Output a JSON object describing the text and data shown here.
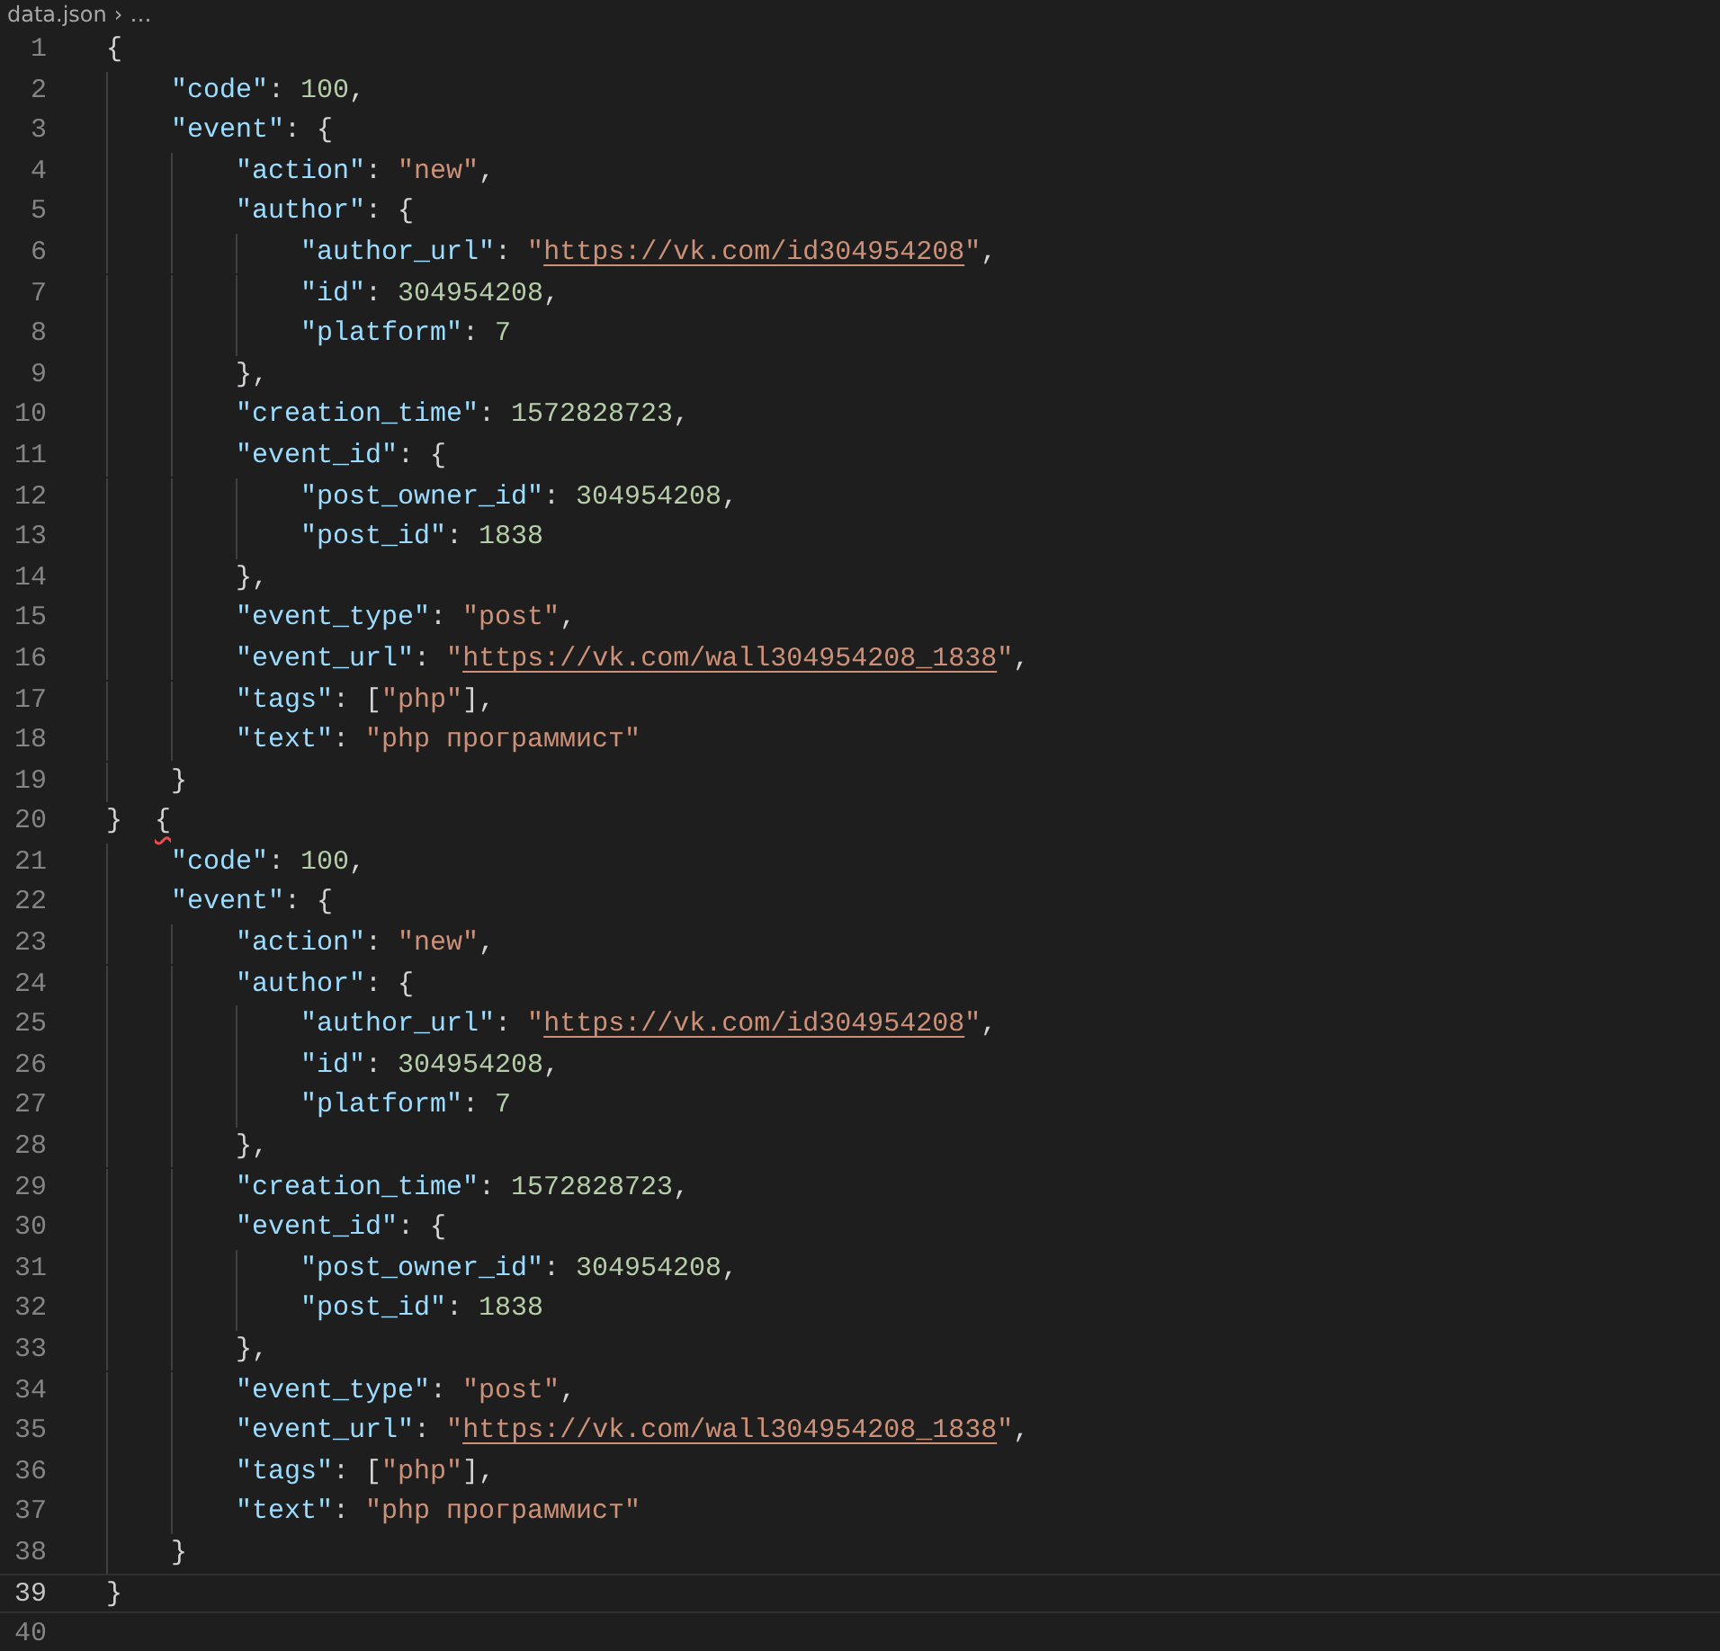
{
  "breadcrumb": {
    "file": "data.json",
    "separator": "›",
    "rest": "…"
  },
  "lines": [
    {
      "number": "1",
      "current": false,
      "tokens": [
        {
          "kind": "punct",
          "text": "{"
        }
      ],
      "children": [
        {
          "number": "2",
          "current": false,
          "tokens": [
            {
              "kind": "key",
              "text": "\"code\""
            },
            {
              "kind": "punct",
              "text": ": "
            },
            {
              "kind": "num",
              "text": "100"
            },
            {
              "kind": "punct",
              "text": ","
            }
          ]
        },
        {
          "number": "3",
          "current": false,
          "tokens": [
            {
              "kind": "key",
              "text": "\"event\""
            },
            {
              "kind": "punct",
              "text": ": {"
            }
          ],
          "children": [
            {
              "number": "4",
              "current": false,
              "tokens": [
                {
                  "kind": "key",
                  "text": "\"action\""
                },
                {
                  "kind": "punct",
                  "text": ": "
                },
                {
                  "kind": "str",
                  "text": "\"new\""
                },
                {
                  "kind": "punct",
                  "text": ","
                }
              ]
            },
            {
              "number": "5",
              "current": false,
              "tokens": [
                {
                  "kind": "key",
                  "text": "\"author\""
                },
                {
                  "kind": "punct",
                  "text": ": {"
                }
              ],
              "children": [
                {
                  "number": "6",
                  "current": false,
                  "tokens": [
                    {
                      "kind": "key",
                      "text": "\"author_url\""
                    },
                    {
                      "kind": "punct",
                      "text": ": "
                    },
                    {
                      "kind": "str",
                      "text": "\""
                    },
                    {
                      "kind": "url",
                      "text": "https://vk.com/id304954208"
                    },
                    {
                      "kind": "str",
                      "text": "\""
                    },
                    {
                      "kind": "punct",
                      "text": ","
                    }
                  ]
                },
                {
                  "number": "7",
                  "current": false,
                  "tokens": [
                    {
                      "kind": "key",
                      "text": "\"id\""
                    },
                    {
                      "kind": "punct",
                      "text": ": "
                    },
                    {
                      "kind": "num",
                      "text": "304954208"
                    },
                    {
                      "kind": "punct",
                      "text": ","
                    }
                  ]
                },
                {
                  "number": "8",
                  "current": false,
                  "tokens": [
                    {
                      "kind": "key",
                      "text": "\"platform\""
                    },
                    {
                      "kind": "punct",
                      "text": ": "
                    },
                    {
                      "kind": "num",
                      "text": "7"
                    }
                  ]
                }
              ]
            },
            {
              "number": "9",
              "current": false,
              "tokens": [
                {
                  "kind": "punct",
                  "text": "},"
                }
              ]
            },
            {
              "number": "10",
              "current": false,
              "tokens": [
                {
                  "kind": "key",
                  "text": "\"creation_time\""
                },
                {
                  "kind": "punct",
                  "text": ": "
                },
                {
                  "kind": "num",
                  "text": "1572828723"
                },
                {
                  "kind": "punct",
                  "text": ","
                }
              ]
            },
            {
              "number": "11",
              "current": false,
              "tokens": [
                {
                  "kind": "key",
                  "text": "\"event_id\""
                },
                {
                  "kind": "punct",
                  "text": ": {"
                }
              ],
              "children": [
                {
                  "number": "12",
                  "current": false,
                  "tokens": [
                    {
                      "kind": "key",
                      "text": "\"post_owner_id\""
                    },
                    {
                      "kind": "punct",
                      "text": ": "
                    },
                    {
                      "kind": "num",
                      "text": "304954208"
                    },
                    {
                      "kind": "punct",
                      "text": ","
                    }
                  ]
                },
                {
                  "number": "13",
                  "current": false,
                  "tokens": [
                    {
                      "kind": "key",
                      "text": "\"post_id\""
                    },
                    {
                      "kind": "punct",
                      "text": ": "
                    },
                    {
                      "kind": "num",
                      "text": "1838"
                    }
                  ]
                }
              ]
            },
            {
              "number": "14",
              "current": false,
              "tokens": [
                {
                  "kind": "punct",
                  "text": "},"
                }
              ]
            },
            {
              "number": "15",
              "current": false,
              "tokens": [
                {
                  "kind": "key",
                  "text": "\"event_type\""
                },
                {
                  "kind": "punct",
                  "text": ": "
                },
                {
                  "kind": "str",
                  "text": "\"post\""
                },
                {
                  "kind": "punct",
                  "text": ","
                }
              ]
            },
            {
              "number": "16",
              "current": false,
              "tokens": [
                {
                  "kind": "key",
                  "text": "\"event_url\""
                },
                {
                  "kind": "punct",
                  "text": ": "
                },
                {
                  "kind": "str",
                  "text": "\""
                },
                {
                  "kind": "url",
                  "text": "https://vk.com/wall304954208_1838"
                },
                {
                  "kind": "str",
                  "text": "\""
                },
                {
                  "kind": "punct",
                  "text": ","
                }
              ]
            },
            {
              "number": "17",
              "current": false,
              "tokens": [
                {
                  "kind": "key",
                  "text": "\"tags\""
                },
                {
                  "kind": "punct",
                  "text": ": ["
                },
                {
                  "kind": "str",
                  "text": "\"php\""
                },
                {
                  "kind": "punct",
                  "text": "],"
                }
              ]
            },
            {
              "number": "18",
              "current": false,
              "tokens": [
                {
                  "kind": "key",
                  "text": "\"text\""
                },
                {
                  "kind": "punct",
                  "text": ": "
                },
                {
                  "kind": "str",
                  "text": "\"php программист\""
                }
              ]
            }
          ]
        },
        {
          "number": "19",
          "current": false,
          "tokens": [
            {
              "kind": "punct",
              "text": "}"
            }
          ]
        }
      ]
    },
    {
      "number": "20",
      "current": false,
      "tokens": [
        {
          "kind": "punct",
          "text": "}  "
        },
        {
          "kind": "punct",
          "text": "{",
          "error": true
        }
      ],
      "children": [
        {
          "number": "21",
          "current": false,
          "tokens": [
            {
              "kind": "key",
              "text": "\"code\""
            },
            {
              "kind": "punct",
              "text": ": "
            },
            {
              "kind": "num",
              "text": "100"
            },
            {
              "kind": "punct",
              "text": ","
            }
          ]
        },
        {
          "number": "22",
          "current": false,
          "tokens": [
            {
              "kind": "key",
              "text": "\"event\""
            },
            {
              "kind": "punct",
              "text": ": {"
            }
          ],
          "children": [
            {
              "number": "23",
              "current": false,
              "tokens": [
                {
                  "kind": "key",
                  "text": "\"action\""
                },
                {
                  "kind": "punct",
                  "text": ": "
                },
                {
                  "kind": "str",
                  "text": "\"new\""
                },
                {
                  "kind": "punct",
                  "text": ","
                }
              ]
            },
            {
              "number": "24",
              "current": false,
              "tokens": [
                {
                  "kind": "key",
                  "text": "\"author\""
                },
                {
                  "kind": "punct",
                  "text": ": {"
                }
              ],
              "children": [
                {
                  "number": "25",
                  "current": false,
                  "tokens": [
                    {
                      "kind": "key",
                      "text": "\"author_url\""
                    },
                    {
                      "kind": "punct",
                      "text": ": "
                    },
                    {
                      "kind": "str",
                      "text": "\""
                    },
                    {
                      "kind": "url",
                      "text": "https://vk.com/id304954208"
                    },
                    {
                      "kind": "str",
                      "text": "\""
                    },
                    {
                      "kind": "punct",
                      "text": ","
                    }
                  ]
                },
                {
                  "number": "26",
                  "current": false,
                  "tokens": [
                    {
                      "kind": "key",
                      "text": "\"id\""
                    },
                    {
                      "kind": "punct",
                      "text": ": "
                    },
                    {
                      "kind": "num",
                      "text": "304954208"
                    },
                    {
                      "kind": "punct",
                      "text": ","
                    }
                  ]
                },
                {
                  "number": "27",
                  "current": false,
                  "tokens": [
                    {
                      "kind": "key",
                      "text": "\"platform\""
                    },
                    {
                      "kind": "punct",
                      "text": ": "
                    },
                    {
                      "kind": "num",
                      "text": "7"
                    }
                  ]
                }
              ]
            },
            {
              "number": "28",
              "current": false,
              "tokens": [
                {
                  "kind": "punct",
                  "text": "},"
                }
              ]
            },
            {
              "number": "29",
              "current": false,
              "tokens": [
                {
                  "kind": "key",
                  "text": "\"creation_time\""
                },
                {
                  "kind": "punct",
                  "text": ": "
                },
                {
                  "kind": "num",
                  "text": "1572828723"
                },
                {
                  "kind": "punct",
                  "text": ","
                }
              ]
            },
            {
              "number": "30",
              "current": false,
              "tokens": [
                {
                  "kind": "key",
                  "text": "\"event_id\""
                },
                {
                  "kind": "punct",
                  "text": ": {"
                }
              ],
              "children": [
                {
                  "number": "31",
                  "current": false,
                  "tokens": [
                    {
                      "kind": "key",
                      "text": "\"post_owner_id\""
                    },
                    {
                      "kind": "punct",
                      "text": ": "
                    },
                    {
                      "kind": "num",
                      "text": "304954208"
                    },
                    {
                      "kind": "punct",
                      "text": ","
                    }
                  ]
                },
                {
                  "number": "32",
                  "current": false,
                  "tokens": [
                    {
                      "kind": "key",
                      "text": "\"post_id\""
                    },
                    {
                      "kind": "punct",
                      "text": ": "
                    },
                    {
                      "kind": "num",
                      "text": "1838"
                    }
                  ]
                }
              ]
            },
            {
              "number": "33",
              "current": false,
              "tokens": [
                {
                  "kind": "punct",
                  "text": "},"
                }
              ]
            },
            {
              "number": "34",
              "current": false,
              "tokens": [
                {
                  "kind": "key",
                  "text": "\"event_type\""
                },
                {
                  "kind": "punct",
                  "text": ": "
                },
                {
                  "kind": "str",
                  "text": "\"post\""
                },
                {
                  "kind": "punct",
                  "text": ","
                }
              ]
            },
            {
              "number": "35",
              "current": false,
              "tokens": [
                {
                  "kind": "key",
                  "text": "\"event_url\""
                },
                {
                  "kind": "punct",
                  "text": ": "
                },
                {
                  "kind": "str",
                  "text": "\""
                },
                {
                  "kind": "url",
                  "text": "https://vk.com/wall304954208_1838"
                },
                {
                  "kind": "str",
                  "text": "\""
                },
                {
                  "kind": "punct",
                  "text": ","
                }
              ]
            },
            {
              "number": "36",
              "current": false,
              "tokens": [
                {
                  "kind": "key",
                  "text": "\"tags\""
                },
                {
                  "kind": "punct",
                  "text": ": ["
                },
                {
                  "kind": "str",
                  "text": "\"php\""
                },
                {
                  "kind": "punct",
                  "text": "],"
                }
              ]
            },
            {
              "number": "37",
              "current": false,
              "tokens": [
                {
                  "kind": "key",
                  "text": "\"text\""
                },
                {
                  "kind": "punct",
                  "text": ": "
                },
                {
                  "kind": "str",
                  "text": "\"php программист\""
                }
              ]
            }
          ]
        },
        {
          "number": "38",
          "current": false,
          "tokens": [
            {
              "kind": "punct",
              "text": "}"
            }
          ]
        }
      ]
    },
    {
      "number": "39",
      "current": true,
      "tokens": [
        {
          "kind": "punct",
          "text": "}"
        }
      ]
    },
    {
      "number": "40",
      "current": false
    }
  ]
}
